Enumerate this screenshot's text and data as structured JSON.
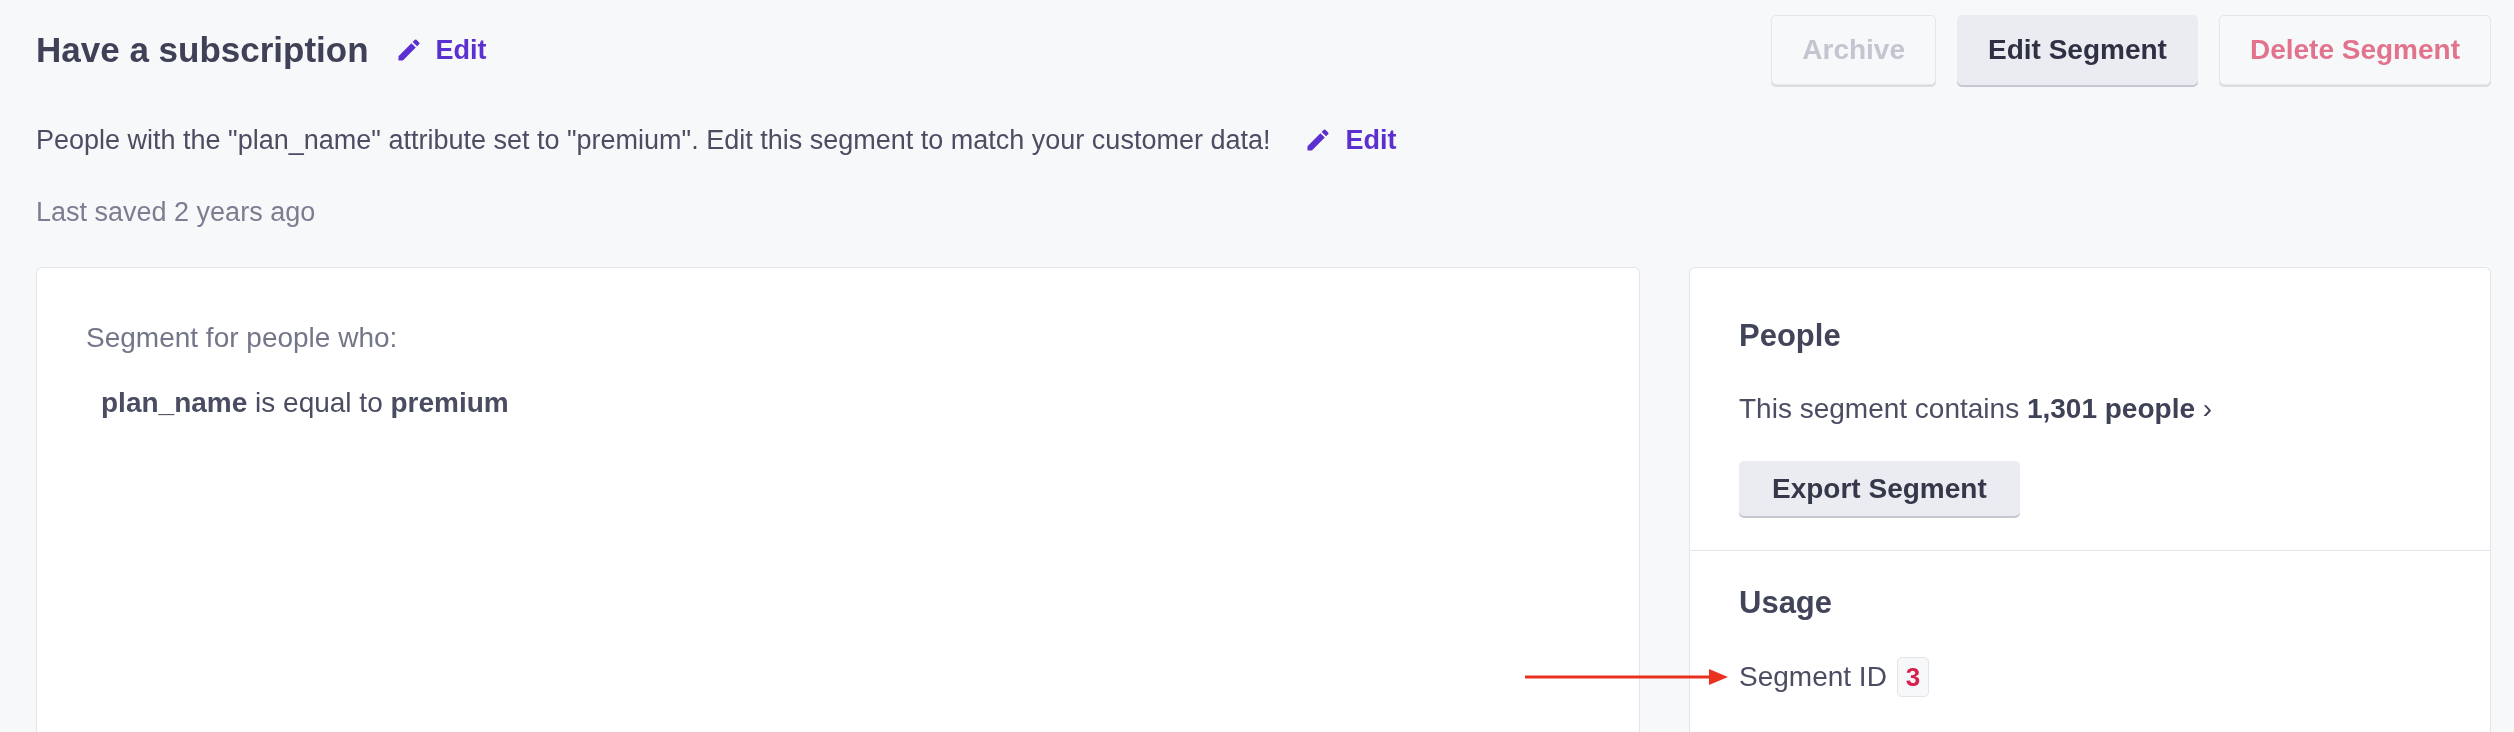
{
  "header": {
    "title": "Have a subscription",
    "edit_label": "Edit",
    "actions": [
      {
        "label": "Archive",
        "kind": "outline",
        "disabled": true
      },
      {
        "label": "Edit Segment",
        "kind": "filled",
        "disabled": false
      },
      {
        "label": "Delete Segment",
        "kind": "danger",
        "disabled": false
      }
    ]
  },
  "description": {
    "text": "People with the \"plan_name\" attribute set to \"premium\". Edit this segment to match your customer data!",
    "edit_label": "Edit"
  },
  "last_saved": "Last saved 2 years ago",
  "conditions_card": {
    "heading": "Segment for people who:",
    "conditions": [
      "**plan_name** is equal to **premium**"
    ]
  },
  "people_card": {
    "title": "People",
    "summary": "This segment contains",
    "link": "**1,301 people** ›",
    "export_button": "Export Segment"
  },
  "usage_card": {
    "title": "Usage",
    "id_label": "Segment ID",
    "id_value": "3"
  }
}
